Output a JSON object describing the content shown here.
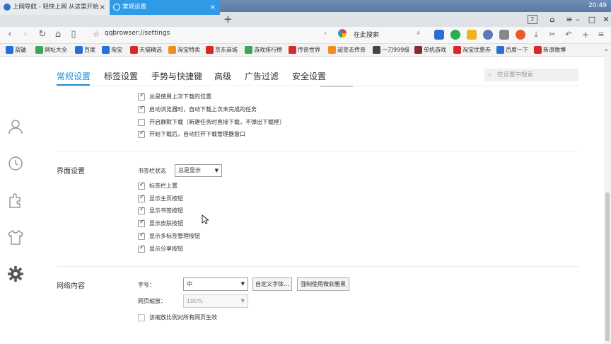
{
  "taskbar": {
    "time": "20:49"
  },
  "tabs": [
    {
      "label": "上网导航 - 轻快上网 从这里开始",
      "close": "×",
      "active": false
    },
    {
      "label": "常规设置",
      "close": "×",
      "active": true
    }
  ],
  "tab_add": "+",
  "tab_count": "2",
  "window_controls": {
    "minimize": "–",
    "maximize": "□",
    "close": "✕"
  },
  "address": {
    "url": "qqbrowser://settings",
    "search_placeholder": "在此搜索"
  },
  "bookmarks": [
    {
      "label": "蓝鼬",
      "color": "#2a6fd6"
    },
    {
      "label": "网址大全",
      "color": "#3aa65b"
    },
    {
      "label": "百度",
      "color": "#2a6fd6"
    },
    {
      "label": "淘宝",
      "color": "#2a6fd6"
    },
    {
      "label": "天猫精选",
      "color": "#d62a2a"
    },
    {
      "label": "淘宝特卖",
      "color": "#f28c1f"
    },
    {
      "label": "京东商城",
      "color": "#d62a2a"
    },
    {
      "label": "游戏排行榜",
      "color": "#3aa65b"
    },
    {
      "label": "传奇世界",
      "color": "#d62a2a"
    },
    {
      "label": "超变态传奇",
      "color": "#f28c1f"
    },
    {
      "label": "一刀999级",
      "color": "#444444"
    },
    {
      "label": "单机游戏",
      "color": "#8a2a2a"
    },
    {
      "label": "淘宝优惠券",
      "color": "#d62a2a"
    },
    {
      "label": "百度一下",
      "color": "#2a6fd6"
    },
    {
      "label": "新浪微博",
      "color": "#d62a2a"
    }
  ],
  "settings_tabs": [
    "常规设置",
    "标签设置",
    "手势与快捷键",
    "高级",
    "广告过滤",
    "安全设置"
  ],
  "settings_search_placeholder": "在设置中搜索",
  "download_options": [
    {
      "label": "总是使用上次下载的位置",
      "checked": true
    },
    {
      "label": "启动浏览器时，自动下载上次未完成的任务",
      "checked": true
    },
    {
      "label": "开启静默下载（新建任务时直接下载，不弹出下载框）",
      "checked": false
    },
    {
      "label": "开始下载后，自动打开下载管理器窗口",
      "checked": true
    }
  ],
  "interface": {
    "title": "界面设置",
    "bookmark_bar_label": "书签栏状态",
    "bookmark_bar_value": "总是显示",
    "options": [
      {
        "label": "标签栏上置",
        "checked": true
      },
      {
        "label": "显示主页按钮",
        "checked": true
      },
      {
        "label": "显示书签按钮",
        "checked": true
      },
      {
        "label": "显示皮肤按钮",
        "checked": true
      },
      {
        "label": "显示多标签管理按钮",
        "checked": true
      },
      {
        "label": "显示分享按钮",
        "checked": true
      }
    ]
  },
  "web": {
    "title": "网络内容",
    "font_size_label": "字号：",
    "font_size_value": "中",
    "custom_font_button": "自定义字体...",
    "force_yahei_button": "强制使用微软雅黑",
    "zoom_label": "网页缩放：",
    "zoom_value": "100%",
    "zoom_all_label": "该缩放比例对所有网页生效",
    "zoom_all_checked": false
  },
  "colors": {
    "accent": "#1d8fd8",
    "active_tab": "#2f9ae5"
  }
}
